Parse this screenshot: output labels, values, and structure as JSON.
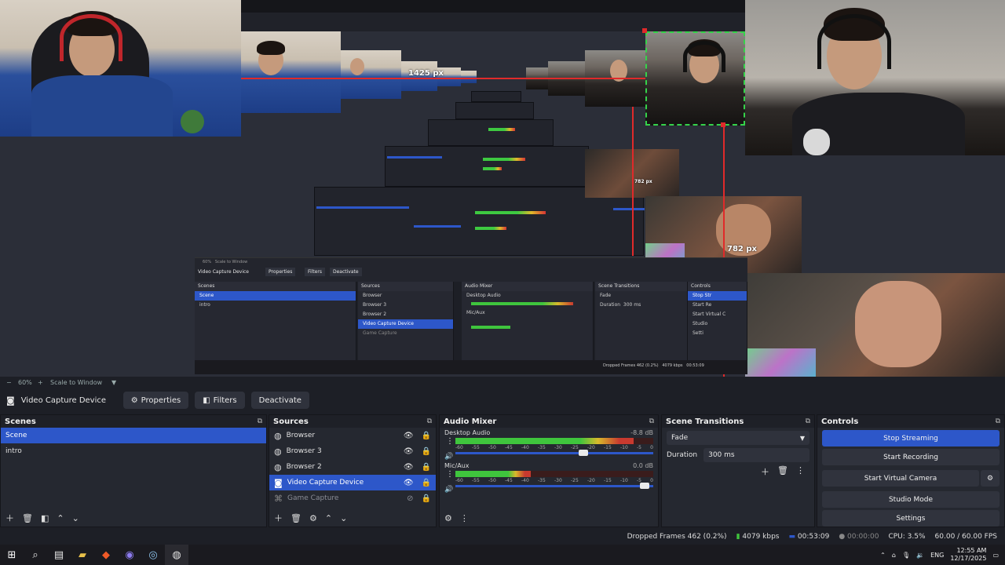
{
  "preview": {
    "measure_top": "1425 px",
    "measure_mid": "782 px",
    "measure_right": "782 px"
  },
  "echo": {
    "zoom": "60%",
    "scale_mode": "Scale to Window",
    "source_name": "Video Capture Device",
    "properties": "Properties",
    "filters": "Filters",
    "deactivate": "Deactivate",
    "scenes_title": "Scenes",
    "sources_title": "Sources",
    "mixer_title": "Audio Mixer",
    "transitions_title": "Scene Transitions",
    "controls_title": "Controls",
    "scenes": [
      "Scene",
      "intro"
    ],
    "sources": [
      "Browser",
      "Browser 3",
      "Browser 2",
      "Video Capture Device",
      "Game Capture"
    ],
    "desktop_audio": "Desktop Audio",
    "mic": "Mic/Aux",
    "fade": "Fade",
    "duration": "Duration",
    "duration_val": "300 ms",
    "stop_streaming": "Stop Str",
    "start_recording": "Start Re",
    "start_virtual": "Start Virtual C",
    "studio": "Studio",
    "settings": "Setti",
    "dropped": "Dropped Frames 462 (0.2%)",
    "kbps": "4079 kbps",
    "time": "00:53:09"
  },
  "toolbar": {
    "zoom": "60%",
    "scale_mode": "Scale to Window",
    "source_name": "Video Capture Device",
    "properties": "Properties",
    "filters": "Filters",
    "deactivate": "Deactivate"
  },
  "scenes": {
    "title": "Scenes",
    "items": [
      "Scene",
      "intro"
    ],
    "selected": 0
  },
  "sources": {
    "title": "Sources",
    "items": [
      {
        "label": "Browser",
        "visible": true
      },
      {
        "label": "Browser 3",
        "visible": true
      },
      {
        "label": "Browser 2",
        "visible": true
      },
      {
        "label": "Video Capture Device",
        "visible": true,
        "selected": true
      },
      {
        "label": "Game Capture",
        "visible": false
      }
    ]
  },
  "mixer": {
    "title": "Audio Mixer",
    "channels": [
      {
        "name": "Desktop Audio",
        "db": "-8.8 dB",
        "level": 0.9,
        "fader": 0.67
      },
      {
        "name": "Mic/Aux",
        "db": "0.0 dB",
        "level": 0.38,
        "fader": 0.98
      }
    ],
    "ticks": [
      "-60",
      "-55",
      "-50",
      "-45",
      "-40",
      "-35",
      "-30",
      "-25",
      "-20",
      "-15",
      "-10",
      "-5",
      "0"
    ]
  },
  "transitions": {
    "title": "Scene Transitions",
    "type": "Fade",
    "duration_label": "Duration",
    "duration_value": "300 ms"
  },
  "controls": {
    "title": "Controls",
    "stop_streaming": "Stop Streaming",
    "start_recording": "Start Recording",
    "start_virtual_camera": "Start Virtual Camera",
    "studio_mode": "Studio Mode",
    "settings": "Settings"
  },
  "status": {
    "dropped_frames": "Dropped Frames 462 (0.2%)",
    "bitrate": "4079 kbps",
    "stream_time": "00:53:09",
    "record_time": "00:00:00",
    "cpu": "CPU: 3.5%",
    "fps": "60.00 / 60.00 FPS"
  },
  "taskbar": {
    "lang": "ENG",
    "time": "12:55 AM",
    "date": "12/17/2025"
  },
  "colors": {
    "accent": "#2d57c9",
    "bg": "#1d1f26",
    "panel": "#252830",
    "live_green": "#3fc53d",
    "measure_red": "#e02a2a"
  }
}
